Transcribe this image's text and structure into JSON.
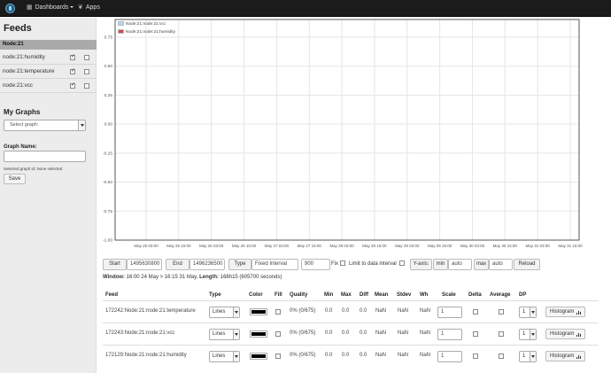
{
  "navbar": {
    "dashboards": "Dashboards",
    "apps": "Apps"
  },
  "sidebar": {
    "title": "Feeds",
    "group": "Node:21",
    "feeds": [
      {
        "name": "node:21:humidity",
        "checked_left": true,
        "checked_right": false
      },
      {
        "name": "node:21:temperature",
        "checked_left": true,
        "checked_right": false
      },
      {
        "name": "node:21:vcc",
        "checked_left": true,
        "checked_right": false
      }
    ],
    "my_graphs": "My Graphs",
    "select_graph": "Select graph:",
    "graph_name_label": "Graph Name:",
    "graph_name_value": "",
    "selected_graph_id": "Selected graph id: None selected",
    "save": "Save"
  },
  "chart_data": {
    "type": "line",
    "legend": [
      "Node:21:node:21:vcc",
      "Node:21:node:21:humidity"
    ],
    "legend_colors": [
      "#afd8f8",
      "#cb4b4b"
    ],
    "y_ticks": [
      "0.75",
      "0.50",
      "0.25",
      "0.00",
      "-0.25",
      "-0.50",
      "-0.75",
      "-1.00"
    ],
    "x_ticks": [
      "May 25 03:00",
      "May 25 15:00",
      "May 26 03:00",
      "May 26 15:00",
      "May 27 03:00",
      "May 27 15:00",
      "May 28 03:00",
      "May 28 15:00",
      "May 29 03:00",
      "May 29 15:00",
      "May 30 03:00",
      "May 30 15:00",
      "May 31 03:00",
      "May 31 15:00"
    ],
    "ylim": [
      -1.0,
      0.75
    ],
    "series": [
      {
        "name": "Node:21:node:21:vcc",
        "values": []
      },
      {
        "name": "Node:21:node:21:humidity",
        "values": []
      }
    ]
  },
  "controls": {
    "start_label": "Start",
    "start_value": "1495630800",
    "end_label": "End",
    "end_value": "1496236500",
    "type_label": "Type",
    "type_value": "Fixed Interval",
    "interval_value": "900",
    "fix_label": "Fix",
    "limit_label": "Limit to data interval",
    "yaxis_label": "Y-axis:",
    "min_label": "min",
    "min_value": "auto",
    "max_label": "max",
    "max_value": "auto",
    "reload": "Reload"
  },
  "window": {
    "window_label": "Window:",
    "window_value": "16:00 24 May > 16:15 31 May,",
    "length_label": "Length:",
    "length_value": "168h15 (605700 seconds)"
  },
  "table": {
    "headers": [
      "Feed",
      "Type",
      "Color",
      "Fill",
      "Quality",
      "Min",
      "Max",
      "Diff",
      "Mean",
      "Stdev",
      "Wh",
      "Scale",
      "Delta",
      "Average",
      "DP"
    ],
    "rows": [
      {
        "feed": "172242:Node:21:node:21:temperature",
        "type": "Lines",
        "color": "#000000",
        "quality": "0% (0/675)",
        "min": "0.0",
        "max": "0.0",
        "diff": "0.0",
        "mean": "NaN",
        "stdev": "NaN",
        "wh": "NaN",
        "scale": "1",
        "dp": "1",
        "histogram": "Histogram"
      },
      {
        "feed": "172243:Node:21:node:21:vcc",
        "type": "Lines",
        "color": "#000000",
        "quality": "0% (0/675)",
        "min": "0.0",
        "max": "0.0",
        "diff": "0.0",
        "mean": "NaN",
        "stdev": "NaN",
        "wh": "NaN",
        "scale": "1",
        "dp": "1",
        "histogram": "Histogram"
      },
      {
        "feed": "172129:Node:21:node:21:humidity",
        "type": "Lines",
        "color": "#000000",
        "quality": "0% (0/675)",
        "min": "0.0",
        "max": "0.0",
        "diff": "0.0",
        "mean": "NaN",
        "stdev": "NaN",
        "wh": "NaN",
        "scale": "1",
        "dp": "1",
        "histogram": "Histogram"
      }
    ]
  }
}
